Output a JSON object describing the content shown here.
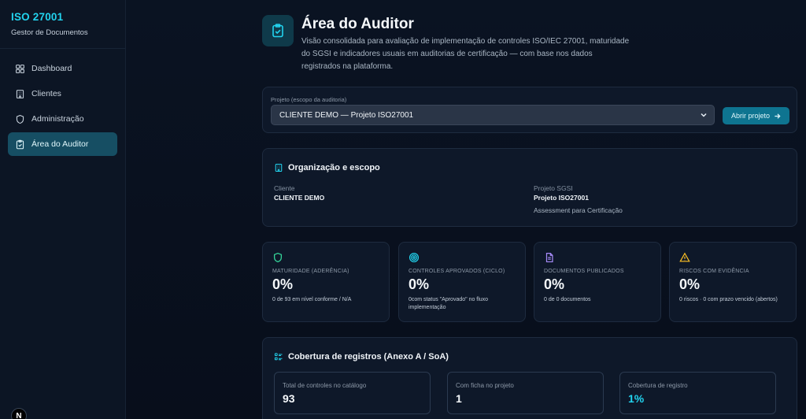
{
  "sidebar": {
    "title": "ISO 27001",
    "subtitle": "Gestor de Documentos",
    "items": [
      {
        "label": "Dashboard",
        "icon": "grid-icon"
      },
      {
        "label": "Clientes",
        "icon": "building-icon"
      },
      {
        "label": "Administração",
        "icon": "shield-icon"
      },
      {
        "label": "Área do Auditor",
        "icon": "clipboard-check-icon",
        "active": true
      }
    ],
    "badge": "N"
  },
  "header": {
    "title": "Área do Auditor",
    "description": "Visão consolidada para avaliação de implementação de controles ISO/IEC 27001, maturidade do SGSI e indicadores usuais em auditorias de certificação — com base nos dados registrados na plataforma."
  },
  "project": {
    "label": "Projeto (escopo da auditoria)",
    "selected": "CLIENTE DEMO — Projeto ISO27001",
    "open_button": "Abrir projeto"
  },
  "org": {
    "title": "Organização e escopo",
    "client_label": "Cliente",
    "client_value": "CLIENTE DEMO",
    "project_label": "Projeto SGSI",
    "project_value": "Projeto ISO27001",
    "project_sub": "Assessment para Certificação"
  },
  "stats": [
    {
      "label": "Maturidade (aderência)",
      "value": "0%",
      "sub": "0 de 93 em nível conforme / N/A",
      "icon": "shield-icon",
      "color": "#34d399"
    },
    {
      "label": "Controles aprovados (ciclo)",
      "value": "0%",
      "sub": "0com status \"Aprovado\" no fluxo implementação",
      "icon": "target-icon",
      "color": "#22d3ee"
    },
    {
      "label": "Documentos publicados",
      "value": "0%",
      "sub": "0 de 0 documentos",
      "icon": "document-icon",
      "color": "#a78bfa"
    },
    {
      "label": "Riscos com evidência",
      "value": "0%",
      "sub": "0 riscos · 0 com prazo vencido (abertos)",
      "icon": "warning-icon",
      "color": "#fbbf24"
    }
  ],
  "coverage": {
    "title": "Cobertura de registros (Anexo A / SoA)",
    "boxes": [
      {
        "label": "Total de controles no catálogo",
        "value": "93"
      },
      {
        "label": "Com ficha no projeto",
        "value": "1"
      },
      {
        "label": "Cobertura de registro",
        "value": "1%"
      }
    ]
  },
  "colors": {
    "accent": "#22d3ee",
    "active_nav": "#164e63",
    "button": "#0e7490"
  }
}
